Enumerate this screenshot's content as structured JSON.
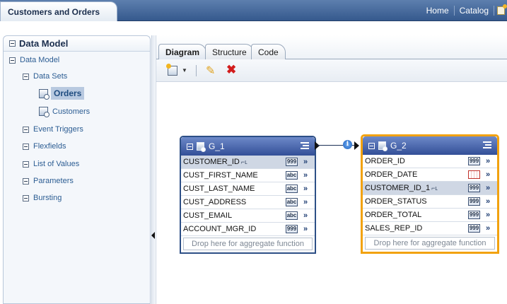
{
  "app": {
    "title": "Customers and Orders",
    "links": [
      "Home",
      "Catalog"
    ]
  },
  "sidebar": {
    "title": "Data Model",
    "root": "Data Model",
    "data_sets_label": "Data Sets",
    "data_sets": [
      "Orders",
      "Customers"
    ],
    "selected_data_set": "Orders",
    "items": [
      "Event Triggers",
      "Flexfields",
      "List of Values",
      "Parameters",
      "Bursting"
    ]
  },
  "tabs": [
    "Diagram",
    "Structure",
    "Code"
  ],
  "active_tab": "Diagram",
  "icons": {
    "new": "new-data-set-icon",
    "edit": "pencil-icon",
    "delete": "delete-x-icon",
    "link_info": "info-icon",
    "group_menu": "group-menu-icon",
    "expand": "double-chevron-right-icon"
  },
  "groups": [
    {
      "name": "G_1",
      "selected": false,
      "fields": [
        {
          "name": "CUSTOMER_ID",
          "type": "999",
          "key": true,
          "highlighted": true
        },
        {
          "name": "CUST_FIRST_NAME",
          "type": "abc",
          "key": false,
          "highlighted": false
        },
        {
          "name": "CUST_LAST_NAME",
          "type": "abc",
          "key": false,
          "highlighted": false
        },
        {
          "name": "CUST_ADDRESS",
          "type": "abc",
          "key": false,
          "highlighted": false
        },
        {
          "name": "CUST_EMAIL",
          "type": "abc",
          "key": false,
          "highlighted": false
        },
        {
          "name": "ACCOUNT_MGR_ID",
          "type": "999",
          "key": false,
          "highlighted": false
        }
      ],
      "drop_text": "Drop here for aggregate function"
    },
    {
      "name": "G_2",
      "selected": true,
      "fields": [
        {
          "name": "ORDER_ID",
          "type": "999",
          "key": false,
          "highlighted": false
        },
        {
          "name": "ORDER_DATE",
          "type": "date",
          "key": false,
          "highlighted": false
        },
        {
          "name": "CUSTOMER_ID_1",
          "type": "999",
          "key": true,
          "highlighted": true
        },
        {
          "name": "ORDER_STATUS",
          "type": "999",
          "key": false,
          "highlighted": false
        },
        {
          "name": "ORDER_TOTAL",
          "type": "999",
          "key": false,
          "highlighted": false
        },
        {
          "name": "SALES_REP_ID",
          "type": "999",
          "key": false,
          "highlighted": false
        }
      ],
      "drop_text": "Drop here for aggregate function"
    }
  ],
  "colors": {
    "header_blue": "#35598d",
    "group_header": "#334f97",
    "selected_border": "#f2a20f",
    "highlight_row": "#cfd7e4",
    "link_text": "#2c5d93"
  }
}
